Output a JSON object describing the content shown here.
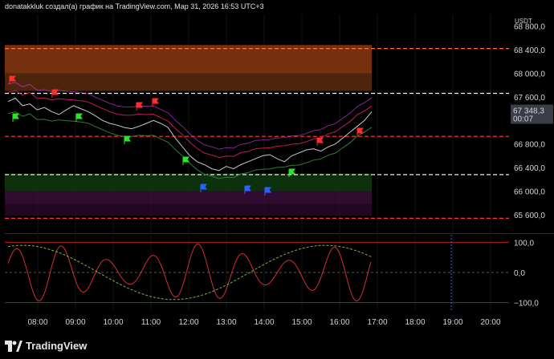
{
  "header": {
    "text": "donatakkluk создал(а) график на TradingView.com, Мар 31, 2026 16:53 UTC+3"
  },
  "footer": {
    "brand": "TradingView"
  },
  "chart_data": {
    "type": "line",
    "currency": "USDT",
    "last_price_label": "67 348,3",
    "countdown_label": "00:07",
    "price_axis": {
      "ylim": [
        65300,
        69000
      ],
      "ticks": [
        {
          "v": 68800,
          "label": "68 800,0"
        },
        {
          "v": 68400,
          "label": "68 400,0"
        },
        {
          "v": 68000,
          "label": "68 000,0"
        },
        {
          "v": 67600,
          "label": "67 600,0"
        },
        {
          "v": 66800,
          "label": "66 800,0"
        },
        {
          "v": 66400,
          "label": "66 400,0"
        },
        {
          "v": 66000,
          "label": "66 000,0"
        },
        {
          "v": 65600,
          "label": "65 600,0"
        }
      ]
    },
    "osc_axis": {
      "ylim": [
        -125,
        125
      ],
      "ticks": [
        {
          "v": 100,
          "label": "100,0"
        },
        {
          "v": 0,
          "label": "0,0"
        },
        {
          "v": -100,
          "label": "−100,0"
        }
      ]
    },
    "time_axis": {
      "ticks": [
        "08:00",
        "09:00",
        "10:00",
        "11:00",
        "12:00",
        "13:00",
        "14:00",
        "15:00",
        "16:00",
        "17:00",
        "18:00",
        "19:00",
        "20:00"
      ]
    },
    "levels": [
      {
        "v": 68420,
        "color": "#ff6d3a",
        "style": "dashed"
      },
      {
        "v": 67660,
        "color": "#ffffff",
        "style": "dashed"
      },
      {
        "v": 66930,
        "color": "#ff3b3b",
        "style": "dashed"
      },
      {
        "v": 66280,
        "color": "#ffffff",
        "style": "dashed"
      },
      {
        "v": 65540,
        "color": "#ff3b3b",
        "style": "dashed"
      }
    ],
    "bands": [
      {
        "from": 68480,
        "to": 68000,
        "color": "#8a3a12"
      },
      {
        "from": 68000,
        "to": 67700,
        "color": "#5a2a0e"
      },
      {
        "from": 66300,
        "to": 66000,
        "color": "#0e3a0e"
      },
      {
        "from": 66000,
        "to": 65780,
        "color": "#3a0e3a"
      },
      {
        "from": 65780,
        "to": 65580,
        "color": "#260a26"
      }
    ],
    "series": [
      {
        "values": [
          67520,
          67580,
          67450,
          67480,
          67380,
          67420,
          67350,
          67300,
          67380,
          67450,
          67400,
          67350,
          67280,
          67200,
          67150,
          67120,
          67080,
          67060,
          67100,
          67150,
          67200,
          67150,
          67080,
          66900,
          66750,
          66600,
          66500,
          66450,
          66380,
          66350,
          66420,
          66380,
          66450,
          66500,
          66550,
          66600,
          66620,
          66550,
          66500,
          66600,
          66650,
          66700,
          66720,
          66680,
          66750,
          66800,
          66900,
          67000,
          67100,
          67200,
          67348
        ]
      }
    ]
  }
}
